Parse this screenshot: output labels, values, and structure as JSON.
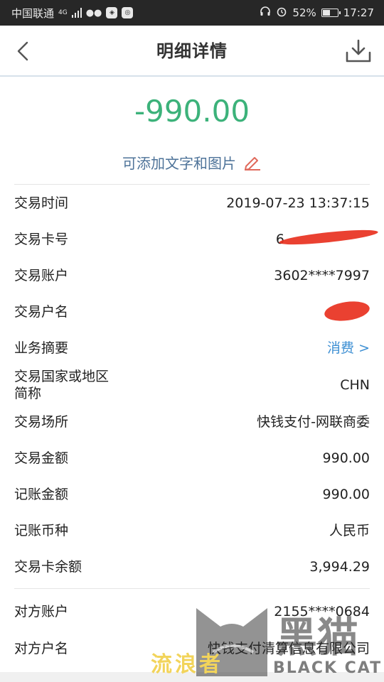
{
  "status_bar": {
    "carrier": "中国联通",
    "network": "4G",
    "battery": "52%",
    "battery_level": 0.52,
    "time": "17:27"
  },
  "nav": {
    "title": "明细详情",
    "back_icon": "chevron-left-icon",
    "download_icon": "download-icon"
  },
  "amount": "-990.00",
  "amount_color": "#3cb27a",
  "note_label": "可添加文字和图片",
  "details": [
    {
      "label": "交易时间",
      "value": "2019-07-23 13:37:15"
    },
    {
      "label": "交易卡号",
      "value": "6"
    },
    {
      "label": "交易账户",
      "value": "3602****7997"
    },
    {
      "label": "交易户名",
      "value": ""
    },
    {
      "label": "业务摘要",
      "value": "消费 >"
    },
    {
      "label": "交易国家或地区简称",
      "value": "CHN"
    },
    {
      "label": "交易场所",
      "value": "快钱支付-网联商委"
    },
    {
      "label": "交易金额",
      "value": "990.00"
    },
    {
      "label": "记账金额",
      "value": "990.00"
    },
    {
      "label": "记账币种",
      "value": "人民币"
    },
    {
      "label": "交易卡余额",
      "value": "3,994.29"
    }
  ],
  "counterparty": [
    {
      "label": "对方账户",
      "value": "2155****0684"
    },
    {
      "label": "对方户名",
      "value": "快钱支付清算信息有限公司"
    }
  ],
  "watermark": {
    "cn": "流浪者",
    "mark": "黑猫",
    "en": "BLACK CAT"
  }
}
